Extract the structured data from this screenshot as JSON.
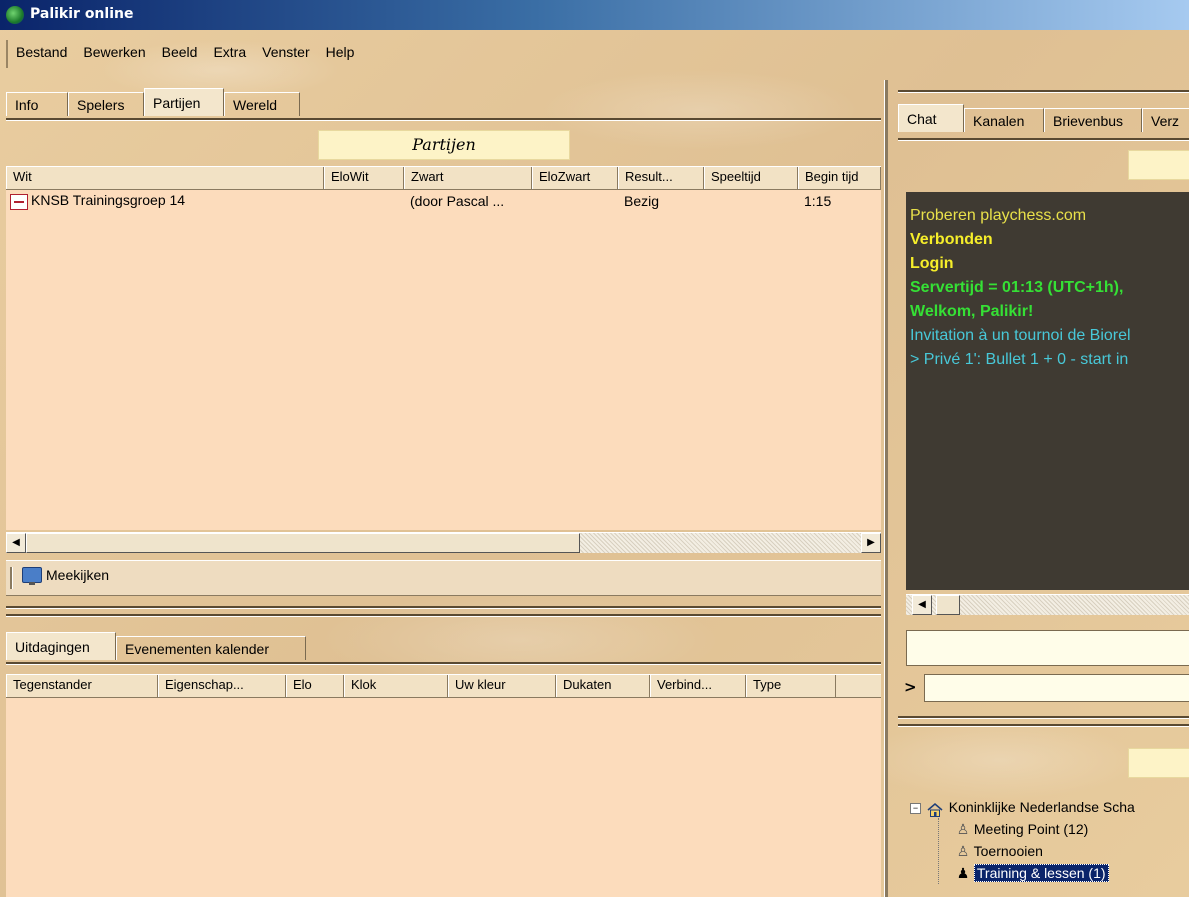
{
  "window": {
    "title": "Palikir online"
  },
  "menu": [
    "Bestand",
    "Bewerken",
    "Beeld",
    "Extra",
    "Venster",
    "Help"
  ],
  "left_tabs": [
    {
      "label": "Info"
    },
    {
      "label": "Spelers"
    },
    {
      "label": "Partijen"
    },
    {
      "label": "Wereld"
    }
  ],
  "games_panel": {
    "title": "Partijen",
    "columns": [
      "Wit",
      "EloWit",
      "Zwart",
      "EloZwart",
      "Result...",
      "Speeltijd",
      "Begin tijd"
    ],
    "rows": [
      {
        "wit": "KNSB Trainingsgroep 14",
        "elowit": "",
        "zwart": "(door Pascal ...",
        "elozwart": "",
        "result": "Bezig",
        "speeltijd": "",
        "begin": "1:15"
      }
    ],
    "watch_button": "Meekijken"
  },
  "bottom_tabs": [
    {
      "label": "Uitdagingen"
    },
    {
      "label": "Evenementen kalender"
    }
  ],
  "challenges": {
    "columns": [
      "Tegenstander",
      "Eigenschap...",
      "Elo",
      "Klok",
      "Uw kleur",
      "Dukaten",
      "Verbind...",
      "Type"
    ]
  },
  "right_tabs": [
    {
      "label": "Chat"
    },
    {
      "label": "Kanalen"
    },
    {
      "label": "Brievenbus"
    },
    {
      "label": "Verz"
    }
  ],
  "chat": {
    "lines": [
      {
        "text": "Proberen playchess.com",
        "color": "#e8e04a",
        "bold": false
      },
      {
        "text": "Verbonden",
        "color": "#f6ee2a",
        "bold": true
      },
      {
        "text": "Login",
        "color": "#f6ee2a",
        "bold": true
      },
      {
        "text": "Servertijd = 01:13 (UTC+1h),",
        "color": "#35e035",
        "bold": true
      },
      {
        "text": "Welkom, Palikir!",
        "color": "#35e035",
        "bold": true
      },
      {
        "text": "Invitation à un tournoi de Biorel",
        "color": "#48c8d8",
        "bold": false
      },
      {
        "text": "> Privé 1': Bullet 1 + 0 - start in",
        "color": "#48c8d8",
        "bold": false
      }
    ],
    "prompt": ">"
  },
  "tree": {
    "root": "Koninklijke Nederlandse Scha",
    "items": [
      {
        "label": "Meeting Point  (12)",
        "selected": false
      },
      {
        "label": "Toernooien",
        "selected": false
      },
      {
        "label": "Training & lessen  (1)",
        "selected": true
      }
    ]
  }
}
